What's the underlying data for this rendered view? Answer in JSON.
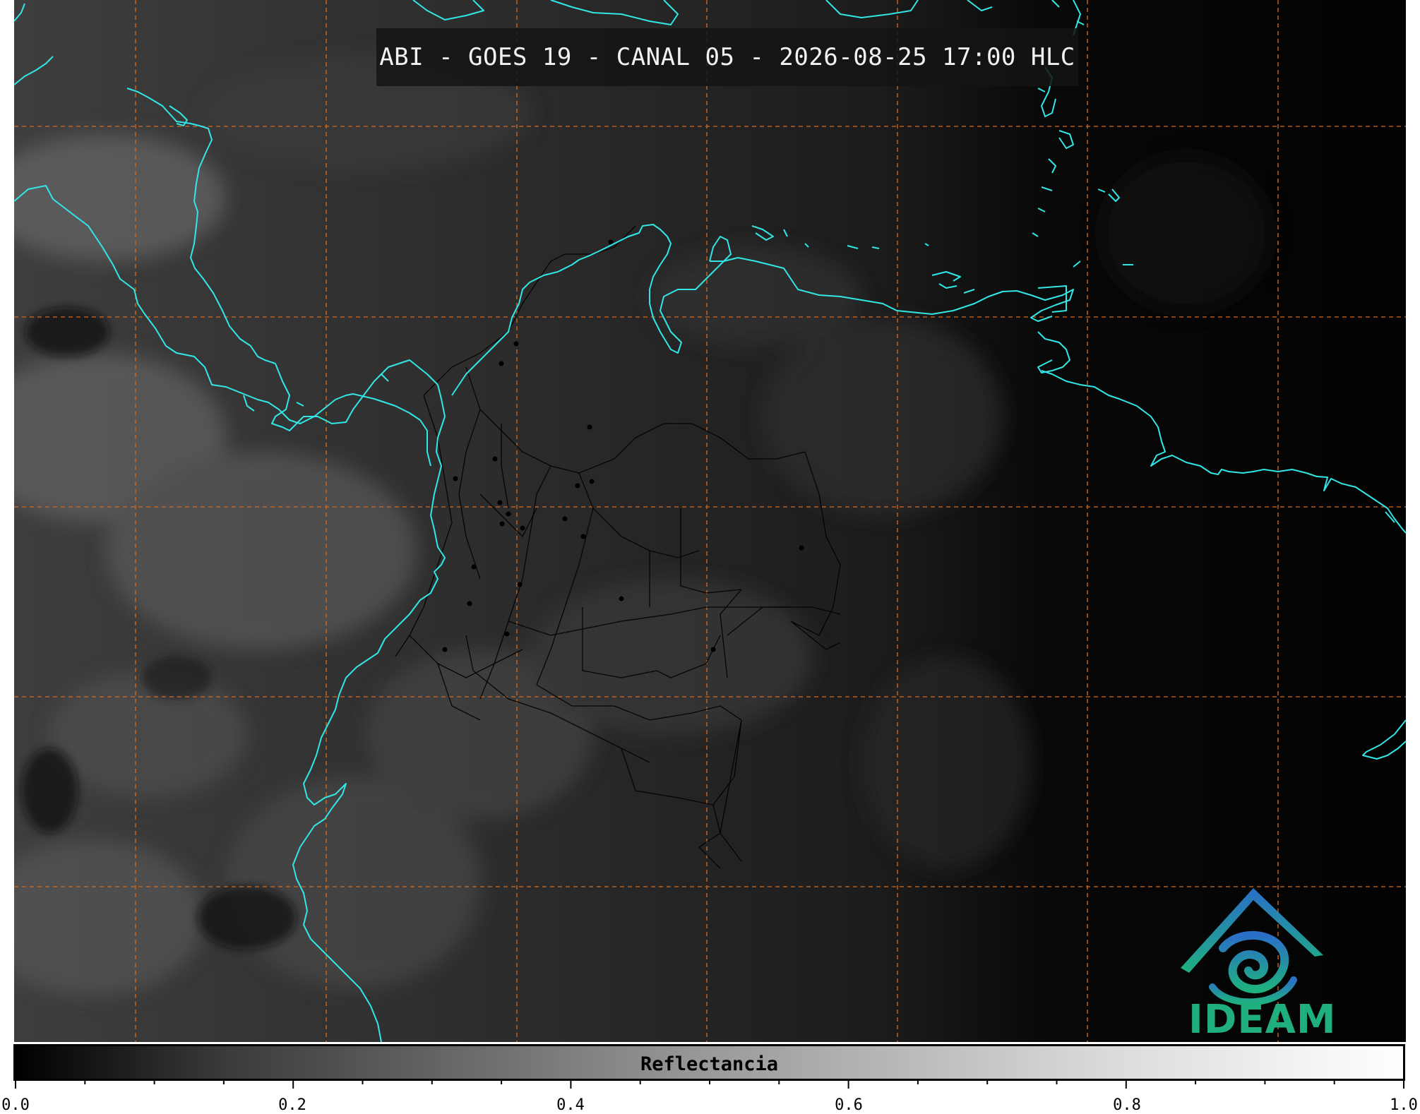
{
  "title": "ABI - GOES 19 - CANAL 05 - 2026-08-25 17:00 HLC",
  "logo": {
    "name": "IDEAM",
    "colors": [
      "#2a7fc4",
      "#1fae80"
    ]
  },
  "colorbar": {
    "label": "Reflectancia",
    "ticks": [
      "0.0",
      "0.2",
      "0.4",
      "0.6",
      "0.8",
      "1.0"
    ],
    "range": [
      0.0,
      1.0
    ],
    "colormap": "grayscale"
  },
  "map": {
    "coastline_color": "#33e6e6",
    "graticule_color": "#d2691e",
    "graticule_style": "dashed",
    "borders_color": "#000000"
  }
}
